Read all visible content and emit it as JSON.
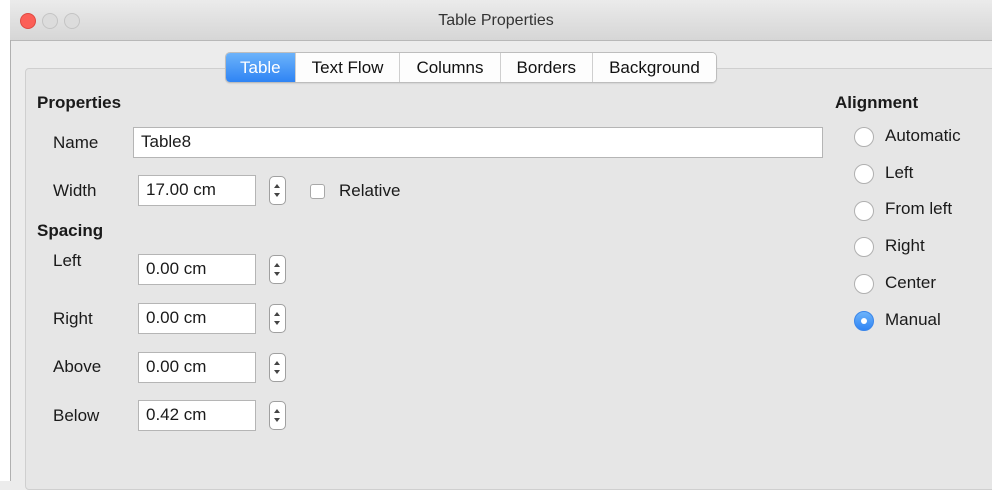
{
  "window": {
    "title": "Table Properties"
  },
  "tabs": [
    {
      "label": "Table",
      "active": true
    },
    {
      "label": "Text Flow",
      "active": false
    },
    {
      "label": "Columns",
      "active": false
    },
    {
      "label": "Borders",
      "active": false
    },
    {
      "label": "Background",
      "active": false
    }
  ],
  "properties": {
    "heading": "Properties",
    "name_label": "Name",
    "name_value": "Table8",
    "width_label": "Width",
    "width_value": "17.00 cm",
    "relative_label": "Relative",
    "relative_checked": false
  },
  "spacing": {
    "heading": "Spacing",
    "left_label": "Left",
    "left_value": "0.00 cm",
    "right_label": "Right",
    "right_value": "0.00 cm",
    "above_label": "Above",
    "above_value": "0.00 cm",
    "below_label": "Below",
    "below_value": "0.42 cm"
  },
  "alignment": {
    "heading": "Alignment",
    "options": [
      {
        "label": "Automatic",
        "checked": false
      },
      {
        "label": "Left",
        "checked": false
      },
      {
        "label": "From left",
        "checked": false
      },
      {
        "label": "Right",
        "checked": false
      },
      {
        "label": "Center",
        "checked": false
      },
      {
        "label": "Manual",
        "checked": true
      }
    ]
  },
  "colors": {
    "accent": "#2f84f4",
    "close": "#fc5f57"
  }
}
